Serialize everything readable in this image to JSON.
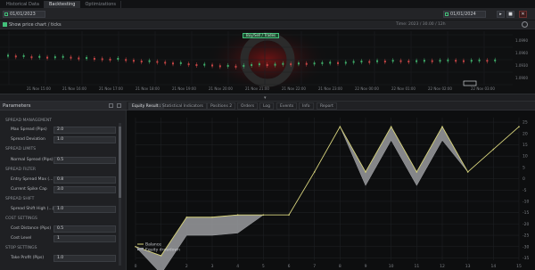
{
  "tabs": [
    {
      "label": "Historical Data",
      "active": false
    },
    {
      "label": "Backtesting",
      "active": true
    },
    {
      "label": "Optimizations",
      "active": false
    }
  ],
  "toolbar": {
    "start_date": "01/01/2023",
    "end_date": "01/01/2024",
    "buttons": [
      "▸",
      "■",
      "✕"
    ]
  },
  "price_panel": {
    "show_label": "Show price chart / ticks",
    "badge": "Buy/Sell / Trades",
    "info": "Time: 2023 / 30.00 / 12h"
  },
  "price_chart": {
    "x_labels": [
      "21 Nov 15:00",
      "21 Nov 16:00",
      "21 Nov 17:00",
      "21 Nov 18:00",
      "21 Nov 19:00",
      "21 Nov 20:00",
      "21 Nov 21:00",
      "21 Nov 22:00",
      "21 Nov 23:00",
      "22 Nov 00:00",
      "22 Nov 01:00",
      "22 Nov 02:00",
      "22 Nov 03:00"
    ],
    "y_labels": [
      "1.0990",
      "1.0960",
      "1.0930",
      "1.0900"
    ],
    "candles": [
      0.42,
      0.44,
      0.43,
      0.46,
      0.45,
      0.47,
      0.46,
      0.45,
      0.47,
      0.49,
      0.48,
      0.5,
      0.51,
      0.52,
      0.5,
      0.53,
      0.55,
      0.57,
      0.56,
      0.58,
      0.6,
      0.62,
      0.61,
      0.64,
      0.66,
      0.65,
      0.67,
      0.69,
      0.68,
      0.7,
      0.68,
      0.66,
      0.64,
      0.66,
      0.65,
      0.63,
      0.64,
      0.62,
      0.63,
      0.62,
      0.61,
      0.6,
      0.61,
      0.6,
      0.58,
      0.57,
      0.58,
      0.56,
      0.57,
      0.55,
      0.56,
      0.57,
      0.56,
      0.55,
      0.56,
      0.55,
      0.54,
      0.55,
      0.56,
      0.55,
      0.54,
      0.55,
      0.54
    ]
  },
  "params_panel": {
    "title": "Parameters",
    "sections": [
      {
        "title": "Spread Management",
        "rows": [
          {
            "label": "Max Spread (Pips)",
            "value": "2.0"
          },
          {
            "label": "Spread Deviation",
            "value": "1.0"
          }
        ]
      },
      {
        "title": "Spread Limits",
        "rows": [
          {
            "label": "Normal Spread (Pips)",
            "value": "0.5"
          }
        ]
      },
      {
        "title": "Spread Filter",
        "rows": [
          {
            "label": "Entry Spread Max (...)",
            "value": "0.8"
          },
          {
            "label": "Current Spike Cap",
            "value": "3.0"
          }
        ]
      },
      {
        "title": "Spread Shift",
        "rows": [
          {
            "label": "Spread Shift High (...)",
            "value": "1.0"
          }
        ]
      },
      {
        "title": "Cost Settings",
        "rows": [
          {
            "label": "Cost Distance (Pips)",
            "value": "0.5"
          },
          {
            "label": "Cost Level",
            "value": "1"
          }
        ]
      },
      {
        "title": "Stop Settings",
        "rows": [
          {
            "label": "Take Profit (Pips)",
            "value": "1.0"
          }
        ]
      }
    ]
  },
  "results_tabs": [
    {
      "label": "Equity Results",
      "active": true
    },
    {
      "label": "Statistical Indicators",
      "active": false
    },
    {
      "label": "Positions 2",
      "active": false
    },
    {
      "label": "Orders",
      "active": false
    },
    {
      "label": "Log",
      "active": false
    },
    {
      "label": "Events",
      "active": false
    },
    {
      "label": "Info",
      "active": false
    },
    {
      "label": "Report",
      "active": false
    }
  ],
  "chart_data": {
    "type": "line",
    "x": [
      0,
      1,
      2,
      3,
      4,
      5,
      6,
      7,
      8,
      9,
      10,
      11,
      12,
      13,
      14,
      15
    ],
    "xlabel": "",
    "ylabel": "",
    "y_ticks": [
      "25",
      "20",
      "15",
      "10",
      "5",
      "0",
      "-5",
      "-10",
      "-15",
      "-20",
      "-25",
      "-30",
      "-35"
    ],
    "series": [
      {
        "name": "Balance",
        "color": "#d6d27a",
        "values": [
          -30,
          -34,
          -17,
          -17,
          -16,
          -16,
          -16,
          3,
          23,
          3,
          23,
          3,
          23,
          3,
          13,
          23
        ]
      },
      {
        "name": "Equity (area)",
        "color": "#b9bbbe",
        "values": [
          -30,
          -34,
          -17,
          -17,
          -16,
          -16,
          -16,
          3,
          23,
          3,
          23,
          3,
          23,
          3,
          13,
          23
        ]
      }
    ],
    "legend": [
      "Balance",
      "Equity drawdown"
    ],
    "ylim": [
      -36,
      27
    ],
    "legend_position": "bottom-left",
    "grid": true
  },
  "colors": {
    "accent": "#43c07a",
    "balance": "#d6d27a",
    "equity": "#9a9c9f"
  }
}
